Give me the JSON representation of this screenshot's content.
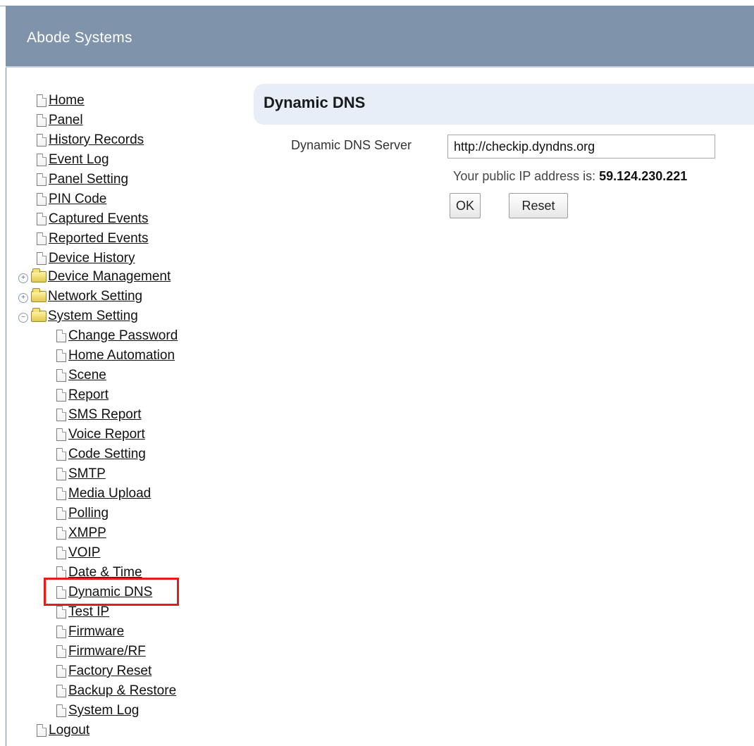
{
  "app": {
    "title": "Abode Systems"
  },
  "sidebar": {
    "top_items": [
      "Home",
      "Panel",
      "History Records",
      "Event Log",
      "Panel Setting",
      "PIN Code",
      "Captured Events",
      "Reported Events",
      "Device History"
    ],
    "folders": [
      "Device Management",
      "Network Setting",
      "System Setting"
    ],
    "system_setting_items": [
      "Change Password",
      "Home Automation",
      "Scene",
      "Report",
      "SMS Report",
      "Voice Report",
      "Code Setting",
      "SMTP",
      "Media Upload",
      "Polling",
      "XMPP",
      "VOIP",
      "Date & Time",
      "Dynamic DNS",
      "Test IP",
      "Firmware",
      "Firmware/RF",
      "Factory Reset",
      "Backup & Restore",
      "System Log"
    ],
    "logout": "Logout",
    "selected_item": "Dynamic DNS",
    "highlight_color": "#e41c1c",
    "icons": {
      "document": "document-icon",
      "folder": "folder-icon",
      "expand": "plus-circle-icon",
      "collapse": "minus-circle-icon"
    }
  },
  "main": {
    "title": "Dynamic DNS",
    "server_label": "Dynamic DNS Server",
    "server_value": "http://checkip.dyndns.org",
    "ip_prefix": "Your public IP address is:",
    "ip_value": "59.124.230.221",
    "ok_label": "OK",
    "reset_label": "Reset"
  },
  "colors": {
    "header_background": "#7f93ab",
    "title_background": "#e7eef8"
  }
}
